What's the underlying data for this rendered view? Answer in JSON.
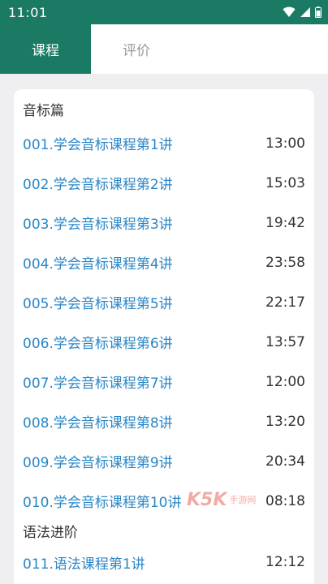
{
  "status_bar": {
    "time": "11:01"
  },
  "tabs": [
    {
      "label": "课程"
    },
    {
      "label": "评价"
    }
  ],
  "sections": [
    {
      "title": "音标篇",
      "lessons": [
        {
          "title": "001.学会音标课程第1讲",
          "duration": "13:00"
        },
        {
          "title": "002.学会音标课程第2讲",
          "duration": "15:03"
        },
        {
          "title": "003.学会音标课程第3讲",
          "duration": "19:42"
        },
        {
          "title": "004.学会音标课程第4讲",
          "duration": "23:58"
        },
        {
          "title": "005.学会音标课程第5讲",
          "duration": "22:17"
        },
        {
          "title": "006.学会音标课程第6讲",
          "duration": "13:57"
        },
        {
          "title": "007.学会音标课程第7讲",
          "duration": "12:00"
        },
        {
          "title": "008.学会音标课程第8讲",
          "duration": "13:20"
        },
        {
          "title": "009.学会音标课程第9讲",
          "duration": "20:34"
        },
        {
          "title": "010.学会音标课程第10讲",
          "duration": "08:18"
        }
      ]
    },
    {
      "title": "语法进阶",
      "lessons": [
        {
          "title": "011.语法课程第1讲",
          "duration": "12:12"
        }
      ]
    }
  ],
  "watermark": {
    "brand": "K5K",
    "text": "手游网"
  },
  "colors": {
    "accent": "#1a7a64",
    "link": "#2a86c6"
  }
}
